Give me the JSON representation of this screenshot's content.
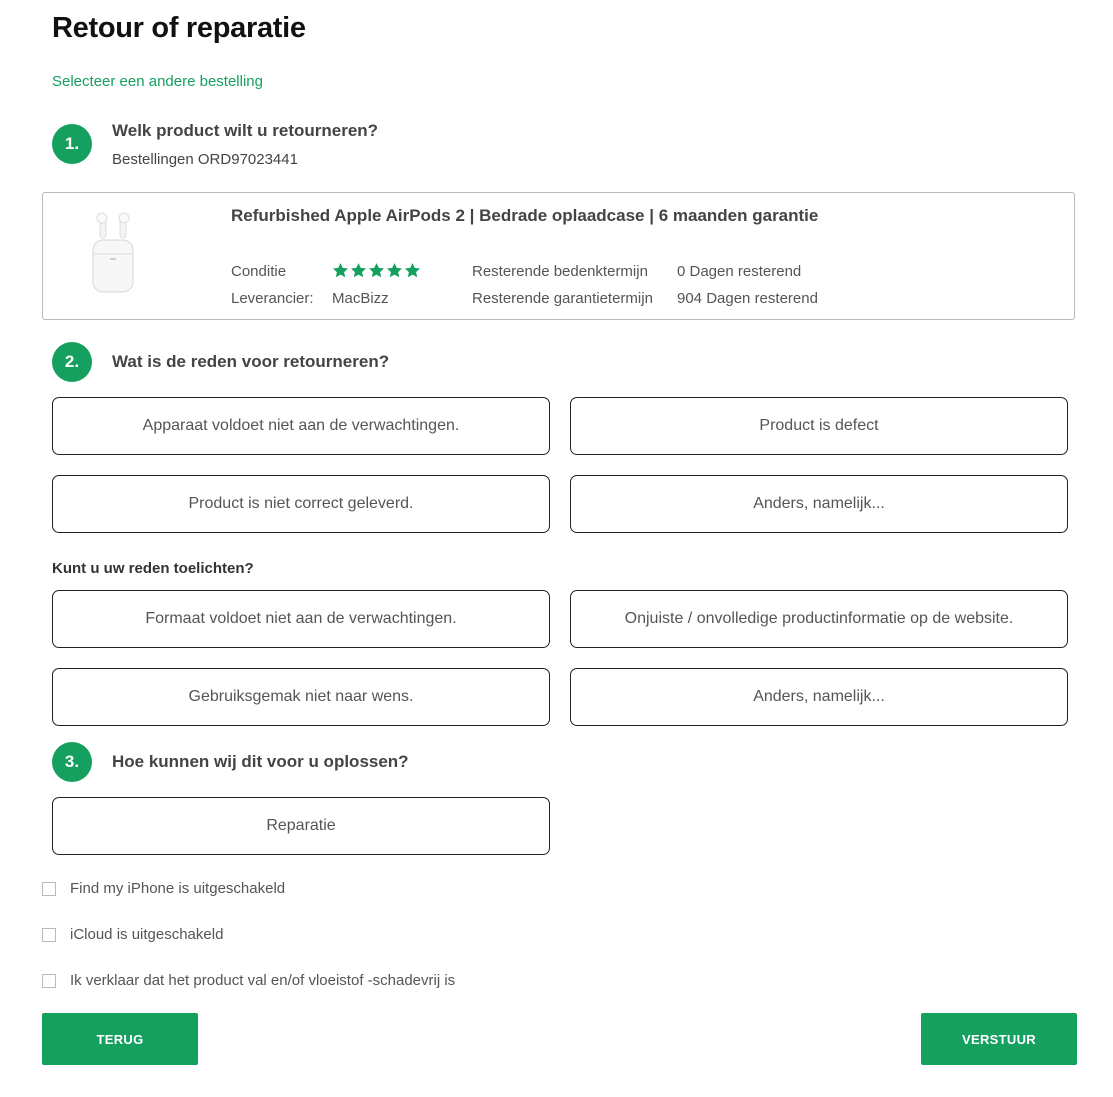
{
  "page": {
    "title": "Retour of reparatie",
    "change_order_link": "Selecteer een andere bestelling"
  },
  "step1": {
    "number": "1.",
    "title": "Welk product wilt u retourneren?",
    "order_label": "Bestellingen ORD97023441"
  },
  "product": {
    "image_icon": "airpods-image",
    "title": "Refurbished Apple AirPods 2 | Bedrade oplaadcase | 6 maanden garantie",
    "condition_label": "Conditie",
    "condition_rating": 5,
    "condition_rating_max": 5,
    "supplier_label": "Leverancier:",
    "supplier_value": "MacBizz",
    "reflection_label": "Resterende bedenktermijn",
    "reflection_value": "0 Dagen resterend",
    "warranty_label": "Resterende garantietermijn",
    "warranty_value": "904 Dagen resterend"
  },
  "step2": {
    "number": "2.",
    "title": "Wat is de reden voor retourneren?",
    "options": [
      "Apparaat voldoet niet aan de verwachtingen.",
      "Product is defect",
      "Product is niet correct geleverd.",
      "Anders, namelijk..."
    ],
    "explain_title": "Kunt u uw reden toelichten?",
    "explain_options": [
      "Formaat voldoet niet aan de verwachtingen.",
      "Onjuiste / onvolledige productinformatie op de website.",
      "Gebruiksgemak niet naar wens.",
      "Anders, namelijk..."
    ]
  },
  "step3": {
    "number": "3.",
    "title": "Hoe kunnen wij dit voor u oplossen?",
    "options": [
      "Reparatie"
    ]
  },
  "checkboxes": [
    {
      "label": "Find my iPhone is uitgeschakeld",
      "checked": false
    },
    {
      "label": "iCloud is uitgeschakeld",
      "checked": false
    },
    {
      "label": "Ik verklaar dat het product val en/of vloeistof -schadevrij is",
      "checked": false
    }
  ],
  "buttons": {
    "back": "TERUG",
    "submit": "VERSTUUR"
  },
  "colors": {
    "accent": "#16a060",
    "border": "#222222"
  }
}
